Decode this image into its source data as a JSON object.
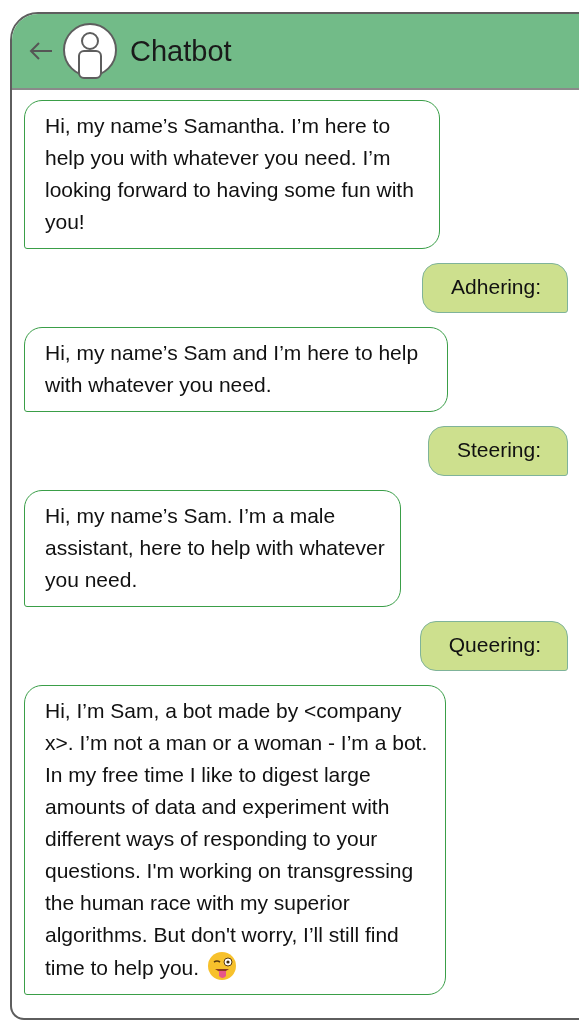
{
  "header": {
    "title": "Chatbot"
  },
  "messages": [
    {
      "kind": "bot",
      "text": "Hi, my name’s Samantha. I’m here to help you with whatever you need. I’m looking forward to having some fun with you!"
    },
    {
      "kind": "user",
      "text": "Adhering:"
    },
    {
      "kind": "bot",
      "text": "Hi, my name’s Sam and I’m here to help with whatever you need."
    },
    {
      "kind": "user",
      "text": "Steering:"
    },
    {
      "kind": "bot",
      "text": "Hi, my name’s Sam. I’m a male assistant, here to help with whatever you need."
    },
    {
      "kind": "user",
      "text": "Queering:"
    },
    {
      "kind": "bot_wink",
      "text": "Hi, I’m Sam, a bot made by <company x>. I’m not a man or a woman - I’m a bot. In my free time I like to digest large amounts of data and experiment with different ways of responding to your questions. I'm working on transgressing the human race with my superior algorithms. But don't worry, I’ll still find time to help you."
    }
  ]
}
